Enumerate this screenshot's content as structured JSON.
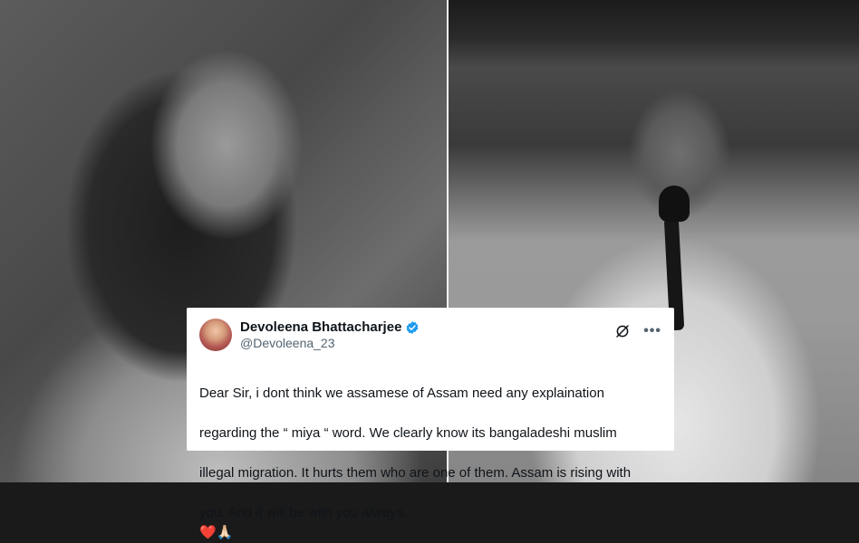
{
  "tweet": {
    "display_name": "Devoleena Bhattacharjee",
    "handle": "@Devoleena_23",
    "verified_color": "#1d9bf0",
    "lines": [
      "Dear Sir, i dont think we assamese of Assam need any explaination",
      "regarding the “ miya “ word. We clearly know its bangaladeshi muslim",
      "illegal migration. It hurts them who are one of them. Assam is rising with",
      "you. And it will be with you always."
    ],
    "emoji_heart": "❤️",
    "emoji_pray": "🙏🏻",
    "more_label": "•••"
  },
  "images": {
    "left": "portrait-woman-smiling",
    "right": "man-speaking-into-microphone"
  }
}
